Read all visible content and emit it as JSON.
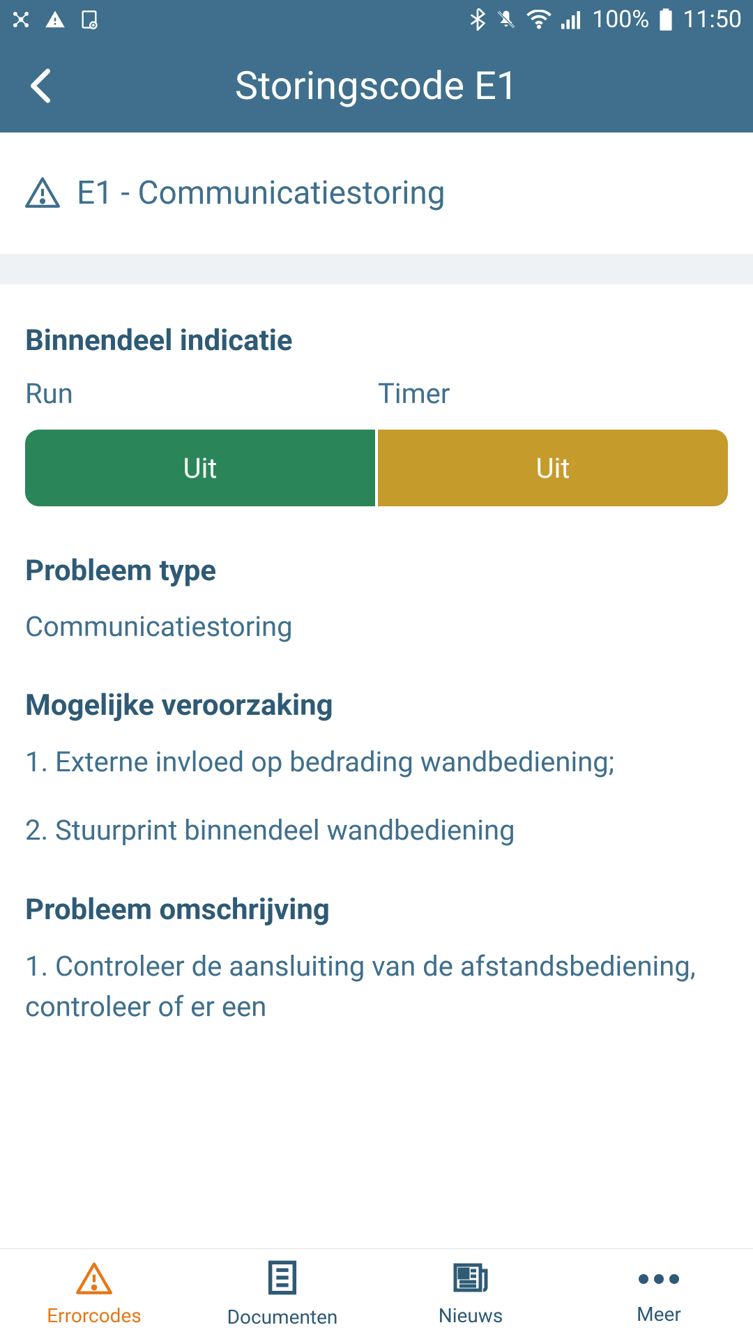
{
  "status_bar": {
    "battery_percent": "100%",
    "time": "11:50"
  },
  "nav": {
    "title": "Storingscode E1"
  },
  "error": {
    "title": "E1 - Communicatiestoring"
  },
  "sections": {
    "indicator": {
      "title": "Binnendeel indicatie",
      "run_label": "Run",
      "timer_label": "Timer",
      "run_value": "Uit",
      "timer_value": "Uit"
    },
    "problem_type": {
      "title": "Probleem type",
      "value": "Communicatiestoring"
    },
    "possible_cause": {
      "title": "Mogelijke veroorzaking",
      "items": [
        "1. Externe invloed op bedrading wandbediening;",
        "2. Stuurprint binnendeel wandbediening"
      ]
    },
    "description": {
      "title": "Probleem omschrijving",
      "items": [
        "1. Controleer de aansluiting van de afstandsbediening, controleer of er een"
      ]
    }
  },
  "bottom_nav": {
    "errorcodes": "Errorcodes",
    "documenten": "Documenten",
    "nieuws": "Nieuws",
    "meer": "Meer"
  }
}
